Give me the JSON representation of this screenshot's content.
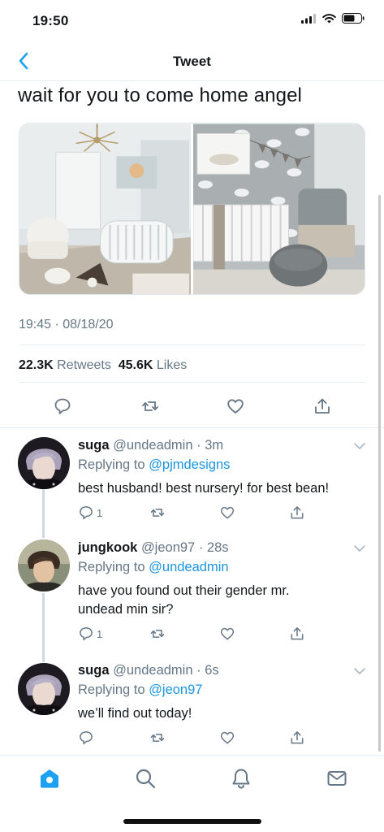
{
  "status_bar": {
    "time": "19:50",
    "icons": [
      "signal-icon",
      "wifi-icon",
      "battery-icon"
    ]
  },
  "nav": {
    "title": "Tweet",
    "back_icon": "chevron-left-icon"
  },
  "tweet": {
    "text": "wait for you to come home angel",
    "timestamp": "19:45 · 08/18/20",
    "retweets_count": "22.3K",
    "retweets_label": "Retweets",
    "likes_count": "45.6K",
    "likes_label": "Likes",
    "actions": [
      "reply-icon",
      "retweet-icon",
      "like-icon",
      "share-icon"
    ]
  },
  "replies": [
    {
      "name": "suga",
      "handle": "@undeadmin",
      "time": "· 3m",
      "replying_prefix": "Replying to",
      "replying_to": "@pjmdesigns",
      "text": "best husband! best nursery! for best bean!",
      "reply_count": "1"
    },
    {
      "name": "jungkook",
      "handle": "@jeon97",
      "time": "· 28s",
      "replying_prefix": "Replying to",
      "replying_to": "@undeadmin",
      "text": "have you found out their gender mr. undead min sir?",
      "reply_count": "1"
    },
    {
      "name": "suga",
      "handle": "@undeadmin",
      "time": "· 6s",
      "replying_prefix": "Replying to",
      "replying_to": "@jeon97",
      "text": "we’ll find out today!",
      "reply_count": ""
    }
  ],
  "tab_bar": {
    "tabs": [
      "home-icon",
      "search-icon",
      "notifications-icon",
      "messages-icon"
    ],
    "active": "home-icon"
  },
  "colors": {
    "accent": "#1da1f2",
    "mention": "#1b95e0",
    "secondary_text": "#657786",
    "divider": "#e6ecf0"
  }
}
